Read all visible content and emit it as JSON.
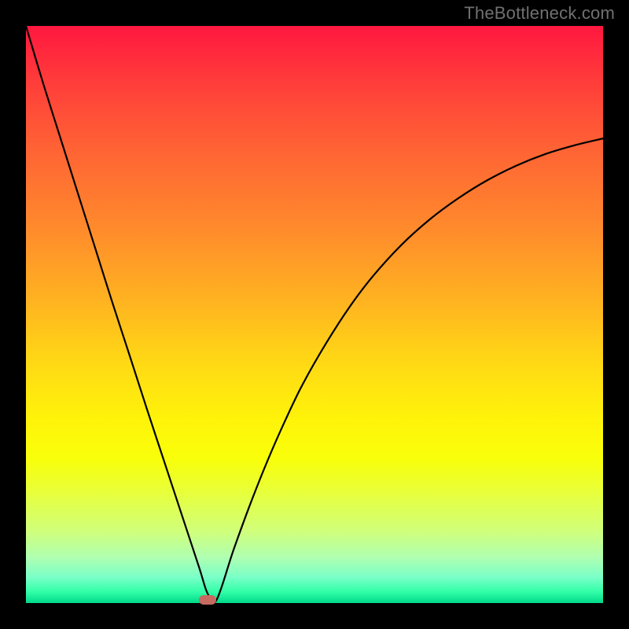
{
  "watermark": "TheBottleneck.com",
  "chart_data": {
    "type": "line",
    "title": "",
    "xlabel": "",
    "ylabel": "",
    "xlim": [
      0,
      100
    ],
    "ylim": [
      0,
      100
    ],
    "grid": false,
    "background": "rainbow-gradient-vertical",
    "gradient_stops": [
      {
        "pos": 0,
        "color": "#ff173f"
      },
      {
        "pos": 25,
        "color": "#ff7a30"
      },
      {
        "pos": 50,
        "color": "#ffc81c"
      },
      {
        "pos": 70,
        "color": "#fff80a"
      },
      {
        "pos": 88,
        "color": "#ccff88"
      },
      {
        "pos": 100,
        "color": "#00d98a"
      }
    ],
    "series": [
      {
        "name": "bottleneck-curve",
        "stroke": "#000000",
        "x": [
          0,
          3,
          6,
          9,
          12,
          15,
          18,
          21,
          24,
          27,
          30,
          31.5,
          33,
          36,
          39,
          42,
          45,
          48,
          52,
          56,
          60,
          65,
          70,
          75,
          80,
          85,
          90,
          95,
          100
        ],
        "y": [
          100,
          90,
          80.5,
          71,
          61.5,
          52,
          42.8,
          33.5,
          24.4,
          15.3,
          6.2,
          1.6,
          0.5,
          9.3,
          17.5,
          25,
          31.8,
          38,
          45,
          51.2,
          56.5,
          62,
          66.5,
          70.2,
          73.3,
          75.8,
          77.8,
          79.3,
          80.5
        ]
      }
    ],
    "marker": {
      "name": "optimal-point",
      "x": 31.5,
      "y": 0.5,
      "color": "#c76a60",
      "shape": "pill"
    }
  }
}
